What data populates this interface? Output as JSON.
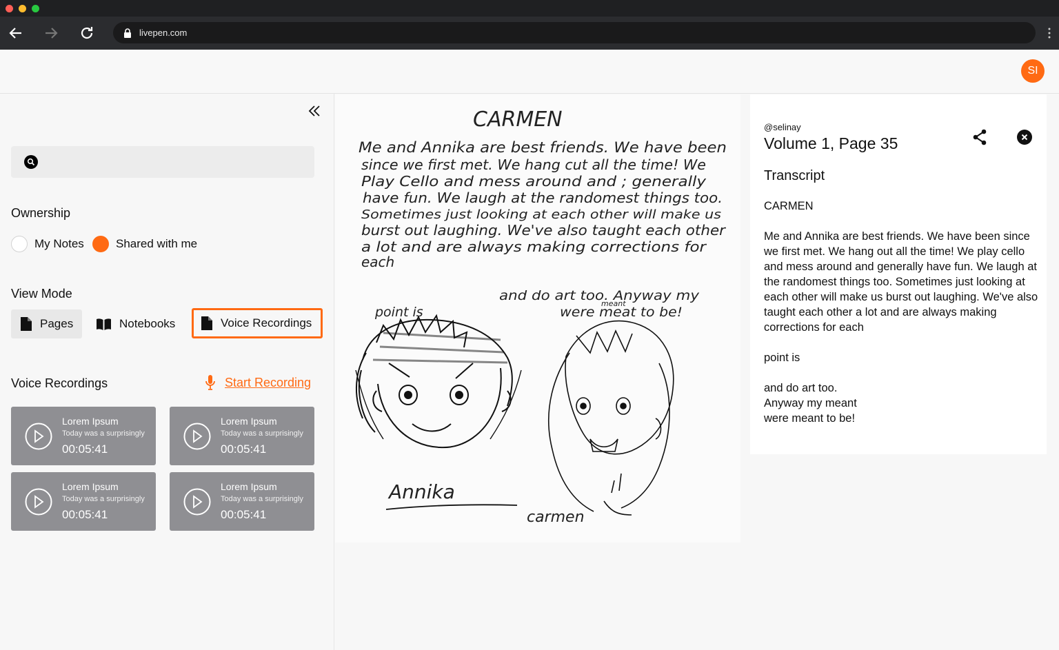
{
  "browser": {
    "url": "livepen.com"
  },
  "header": {
    "avatar_initials": "SI",
    "avatar_color": "#ff6a13"
  },
  "sidebar": {
    "search_placeholder": "",
    "ownership": {
      "label": "Ownership",
      "options": [
        {
          "label": "My Notes",
          "selected": false
        },
        {
          "label": "Shared with me",
          "selected": true
        }
      ]
    },
    "view_mode": {
      "label": "View Mode",
      "options": [
        "Pages",
        "Notebooks",
        "Voice Recordings"
      ],
      "selected": "Voice Recordings"
    },
    "voice_recordings": {
      "label": "Voice Recordings",
      "start_label": "Start Recording",
      "items": [
        {
          "title": "Lorem Ipsum",
          "snippet": "Today was a surprisingly",
          "duration": "00:05:41"
        },
        {
          "title": "Lorem Ipsum",
          "snippet": "Today was a surprisingly",
          "duration": "00:05:41"
        },
        {
          "title": "Lorem Ipsum",
          "snippet": "Today was a surprisingly",
          "duration": "00:05:41"
        },
        {
          "title": "Lorem Ipsum",
          "snippet": "Today was a surprisingly",
          "duration": "00:05:41"
        }
      ]
    }
  },
  "note_page": {
    "handwriting": {
      "title": "CARMEN",
      "lines": [
        "Me and Annika are best friends. We have been",
        "since we first met. We hang cut all the time! We",
        "Play Cello and mess around and ; generally",
        "have fun. We laugh at the randomest things too.",
        "Sometimes just looking at each other will make us",
        "burst out laughing. We've also taught each other",
        "a lot and are always making corrections for",
        "each"
      ],
      "point_is": "point is",
      "art_line1": "and do art too. Anyway my",
      "art_line2": "were meat to be!",
      "meant": "meant",
      "name_left": "Annika",
      "name_right": "carmen"
    }
  },
  "transcript_panel": {
    "username": "@selinay",
    "title": "Volume 1, Page 35",
    "heading": "Transcript",
    "text": "CARMEN\n\nMe and Annika are best friends. We have been since we first met. We hang out all the time! We play cello and mess around and generally have fun. We laugh at the randomest things too. Sometimes just looking at each other will make us burst out laughing. We've also taught each other a lot and are always making corrections for each\n\npoint is\n\nand do art too.\nAnyway my meant\nwere meant to be!"
  }
}
